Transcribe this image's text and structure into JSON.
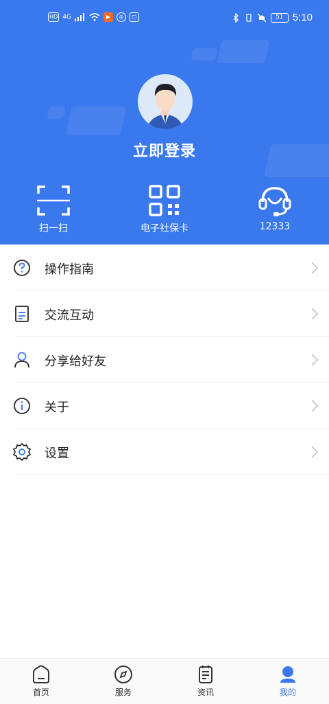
{
  "status_bar": {
    "left_chips": [
      "HD",
      "4G",
      "▶",
      "◎",
      "◻"
    ],
    "time": "5:10",
    "battery": "51"
  },
  "profile": {
    "login_label": "立即登录"
  },
  "quick_actions": [
    {
      "label": "扫一扫",
      "icon": "scan-icon"
    },
    {
      "label": "电子社保卡",
      "icon": "qr-code-icon"
    },
    {
      "label": "12333",
      "icon": "headset-icon"
    }
  ],
  "menu": [
    {
      "label": "操作指南",
      "icon": "question-circle-icon"
    },
    {
      "label": "交流互动",
      "icon": "document-icon"
    },
    {
      "label": "分享给好友",
      "icon": "person-icon"
    },
    {
      "label": "关于",
      "icon": "info-circle-icon"
    },
    {
      "label": "设置",
      "icon": "gear-icon"
    }
  ],
  "tabbar": [
    {
      "label": "首页",
      "icon": "home-icon",
      "active": false
    },
    {
      "label": "服务",
      "icon": "compass-icon",
      "active": false
    },
    {
      "label": "资讯",
      "icon": "news-icon",
      "active": false
    },
    {
      "label": "我的",
      "icon": "profile-icon",
      "active": true
    }
  ],
  "colors": {
    "header_blue": "#3a78ee",
    "active_tab": "#3a78ee",
    "text": "#222222",
    "chevron": "#c7c7c7"
  }
}
